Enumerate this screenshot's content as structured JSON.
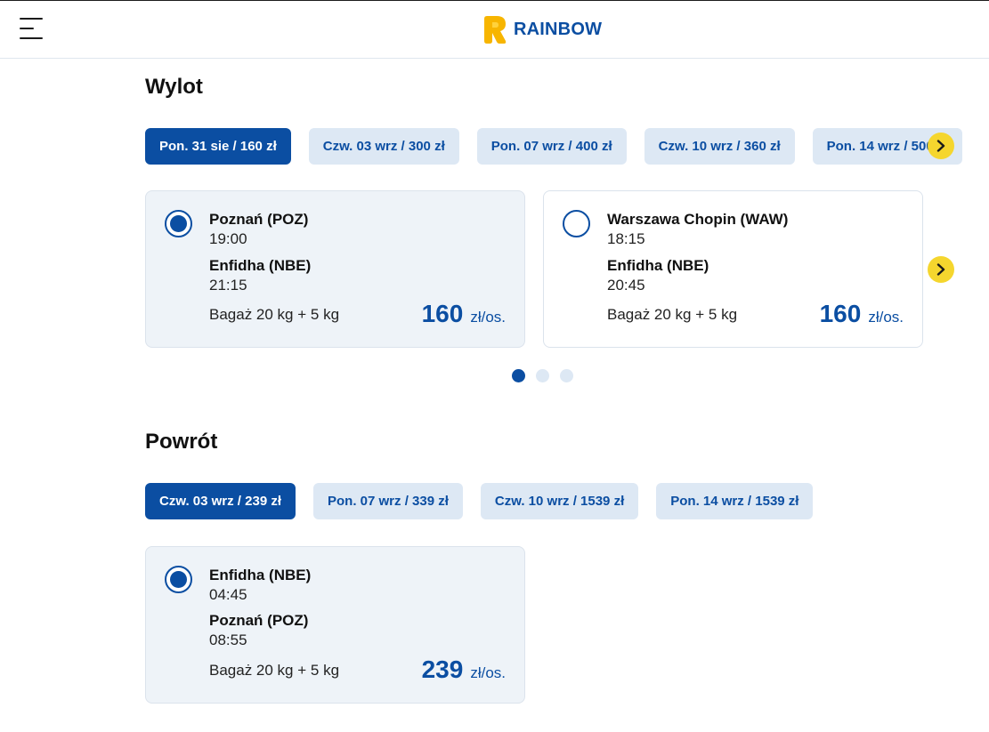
{
  "header": {
    "logo_text": "RAINBOW"
  },
  "outbound": {
    "title": "Wylot",
    "tabs": [
      {
        "label": "Pon. 31 sie / 160 zł",
        "active": true
      },
      {
        "label": "Czw. 03 wrz / 300 zł",
        "active": false
      },
      {
        "label": "Pon. 07 wrz / 400 zł",
        "active": false
      },
      {
        "label": "Czw. 10 wrz / 360 zł",
        "active": false
      },
      {
        "label": "Pon. 14 wrz / 500 zł",
        "active": false
      }
    ],
    "cards": [
      {
        "selected": true,
        "from_airport": "Poznań (POZ)",
        "from_time": "19:00",
        "to_airport": "Enfidha (NBE)",
        "to_time": "21:15",
        "luggage": "Bagaż 20 kg + 5 kg",
        "price": "160",
        "price_unit": "zł/os."
      },
      {
        "selected": false,
        "from_airport": "Warszawa Chopin (WAW)",
        "from_time": "18:15",
        "to_airport": "Enfidha (NBE)",
        "to_time": "20:45",
        "luggage": "Bagaż 20 kg + 5 kg",
        "price": "160",
        "price_unit": "zł/os."
      }
    ],
    "pagination": {
      "pages": 3,
      "current": 1
    }
  },
  "return": {
    "title": "Powrót",
    "tabs": [
      {
        "label": "Czw. 03 wrz / 239 zł",
        "active": true
      },
      {
        "label": "Pon. 07 wrz / 339 zł",
        "active": false
      },
      {
        "label": "Czw. 10 wrz / 1539 zł",
        "active": false
      },
      {
        "label": "Pon. 14 wrz / 1539 zł",
        "active": false
      }
    ],
    "cards": [
      {
        "selected": true,
        "from_airport": "Enfidha (NBE)",
        "from_time": "04:45",
        "to_airport": "Poznań (POZ)",
        "to_time": "08:55",
        "luggage": "Bagaż 20 kg + 5 kg",
        "price": "239",
        "price_unit": "zł/os."
      }
    ]
  },
  "colors": {
    "brand_blue": "#0b4ea2",
    "tab_inactive_bg": "#dde8f4",
    "accent_yellow": "#f5d62e",
    "card_selected_bg": "#eef3f8"
  },
  "icons": {
    "menu": "hamburger-icon",
    "next": "chevron-right-icon",
    "logo": "rainbow-logo-icon"
  }
}
